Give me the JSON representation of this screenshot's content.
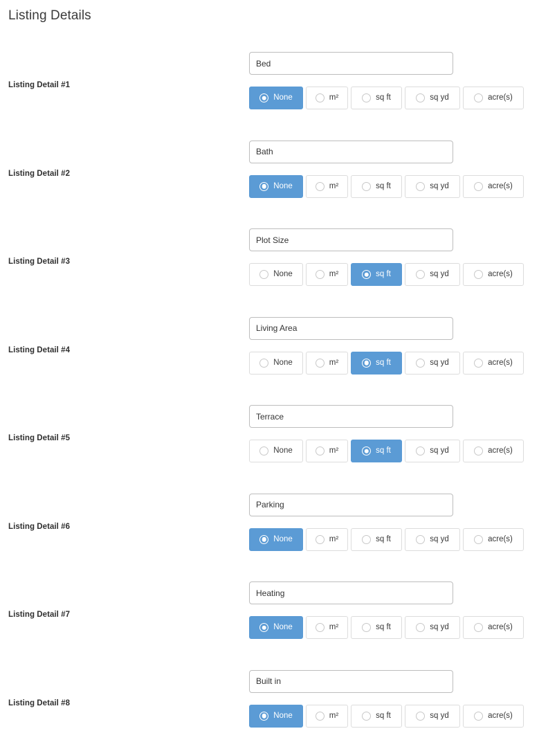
{
  "page": {
    "title": "Listing Details"
  },
  "units": [
    {
      "id": "none",
      "label": "None",
      "width_class": "w-none"
    },
    {
      "id": "m2",
      "label": "m²",
      "width_class": "w-m2"
    },
    {
      "id": "sqft",
      "label": "sq ft",
      "width_class": "w-sqft"
    },
    {
      "id": "sqyd",
      "label": "sq yd",
      "width_class": "w-sqyd"
    },
    {
      "id": "acres",
      "label": "acre(s)",
      "width_class": "w-acres"
    }
  ],
  "colors": {
    "selected_background": "#5b9bd5",
    "selected_text": "#ffffff",
    "input_border": "#bdbdbd",
    "option_border": "#dcdcdc",
    "label_text": "#2f2f2f",
    "title_text": "#3c3c3c",
    "page_background": "#ffffff"
  },
  "rows": [
    {
      "label": "Listing Detail #1",
      "value": "Bed",
      "placeholder": "",
      "selected_unit": "none"
    },
    {
      "label": "Listing Detail #2",
      "value": "Bath",
      "placeholder": "",
      "selected_unit": "none"
    },
    {
      "label": "Listing Detail #3",
      "value": "Plot Size",
      "placeholder": "",
      "selected_unit": "sqft"
    },
    {
      "label": "Listing Detail #4",
      "value": "Living Area",
      "placeholder": "",
      "selected_unit": "sqft"
    },
    {
      "label": "Listing Detail #5",
      "value": "Terrace",
      "placeholder": "",
      "selected_unit": "sqft"
    },
    {
      "label": "Listing Detail #6",
      "value": "Parking",
      "placeholder": "",
      "selected_unit": "none"
    },
    {
      "label": "Listing Detail #7",
      "value": "Heating",
      "placeholder": "",
      "selected_unit": "none"
    },
    {
      "label": "Listing Detail #8",
      "value": "Built in",
      "placeholder": "",
      "selected_unit": "none"
    }
  ]
}
